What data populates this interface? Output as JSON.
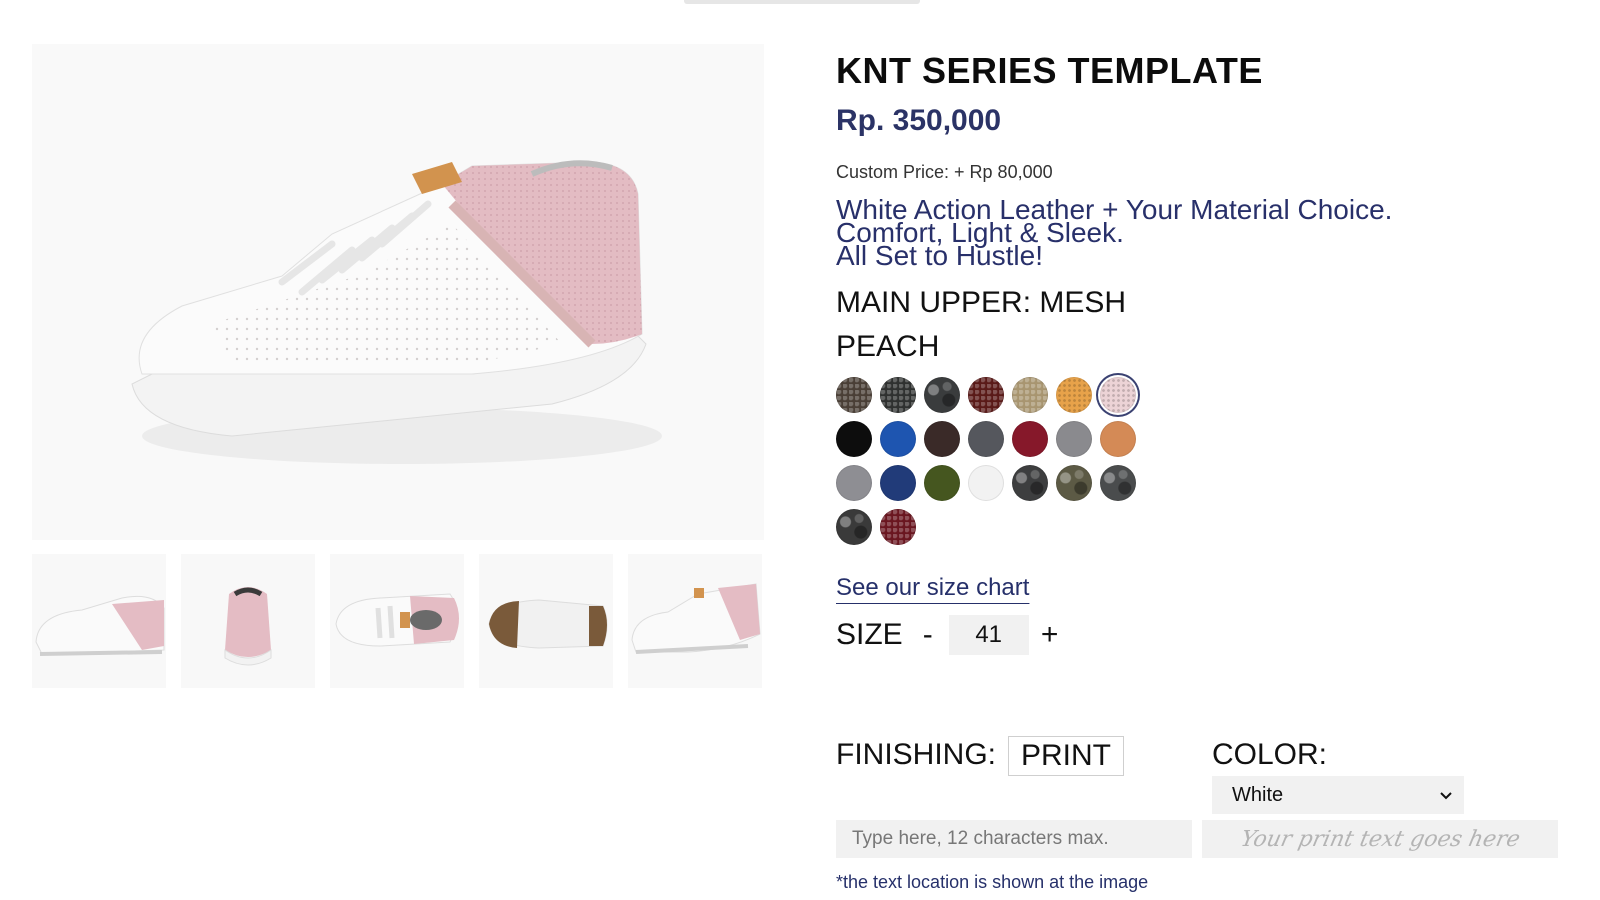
{
  "product": {
    "title": "KNT SERIES TEMPLATE",
    "price": "Rp. 350,000",
    "custom_price": "Custom Price: + Rp 80,000",
    "description_lines": [
      "White Action Leather + Your Material Choice.",
      "Comfort, Light & Sleek.",
      "All Set to Hustle!"
    ],
    "material": "MAIN UPPER: MESH",
    "selected_color_name": "PEACH"
  },
  "swatches": [
    {
      "color": "#4a3f36",
      "pattern": "textured"
    },
    {
      "color": "#2f3130",
      "pattern": "textured"
    },
    {
      "color": "#3a3c3d",
      "pattern": "camo"
    },
    {
      "color": "#5a1a18",
      "pattern": "textured"
    },
    {
      "color": "#a89570",
      "pattern": "textured"
    },
    {
      "color": "#e7a24a",
      "pattern": "mesh"
    },
    {
      "color": "#ecd3d6",
      "pattern": "mesh",
      "selected": true
    },
    {
      "color": "#0d0d0d",
      "pattern": "solid"
    },
    {
      "color": "#1e55b0",
      "pattern": "solid"
    },
    {
      "color": "#3a2a28",
      "pattern": "solid"
    },
    {
      "color": "#55575d",
      "pattern": "solid"
    },
    {
      "color": "#86182a",
      "pattern": "solid"
    },
    {
      "color": "#8a8a8e",
      "pattern": "solid"
    },
    {
      "color": "#d48a56",
      "pattern": "solid"
    },
    {
      "color": "#8e8e93",
      "pattern": "solid"
    },
    {
      "color": "#213b79",
      "pattern": "solid"
    },
    {
      "color": "#45561f",
      "pattern": "solid"
    },
    {
      "color": "#f2f2f2",
      "pattern": "solid"
    },
    {
      "color": "#3d3e3f",
      "pattern": "camo"
    },
    {
      "color": "#5c5a45",
      "pattern": "camo"
    },
    {
      "color": "#4a4c4d",
      "pattern": "camo"
    },
    {
      "color": "#3a3a3a",
      "pattern": "camo"
    },
    {
      "color": "#6a1620",
      "pattern": "textured"
    }
  ],
  "size": {
    "link_text": "See our size chart",
    "label": "SIZE",
    "decrement": "-",
    "increment": "+",
    "value": "41"
  },
  "finishing": {
    "label": "FINISHING:",
    "value": "PRINT"
  },
  "color": {
    "label": "COLOR:",
    "selected": "White",
    "chevron_icon": "chevron-down-icon"
  },
  "print_text": {
    "placeholder": "Type here, 12 characters max.",
    "preview": "Your print text goes here",
    "note": "*the text location is shown at the image"
  },
  "thumbnails": [
    "side",
    "back",
    "top",
    "sole",
    "front-angle"
  ]
}
